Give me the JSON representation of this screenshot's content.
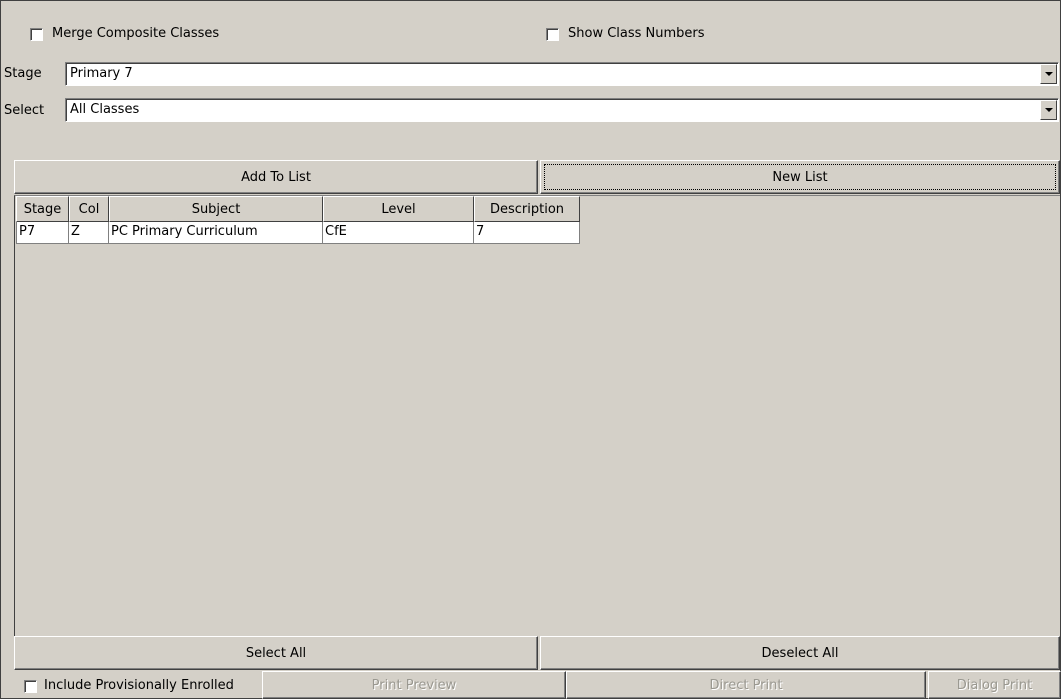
{
  "options": {
    "merge_composite_label": "Merge Composite Classes",
    "show_class_numbers_label": "Show Class Numbers",
    "include_provisionally_label": "Include Provisionally Enrolled"
  },
  "filters": {
    "stage_label": "Stage",
    "stage_value": "Primary 7",
    "select_label": "Select",
    "select_value": "All Classes"
  },
  "buttons": {
    "add_to_list": "Add To List",
    "new_list": "New List",
    "select_all": "Select All",
    "deselect_all": "Deselect All",
    "print_preview": "Print Preview",
    "direct_print": "Direct Print",
    "dialog_print": "Dialog Print"
  },
  "table": {
    "headers": [
      "Stage",
      "Col",
      "Subject",
      "Level",
      "Description"
    ],
    "rows": [
      [
        "P7",
        "Z",
        "PC Primary Curriculum",
        "CfE",
        "7"
      ]
    ]
  },
  "icons": {
    "dropdown": "chevron-down-icon",
    "checkbox": "checkbox-icon"
  }
}
